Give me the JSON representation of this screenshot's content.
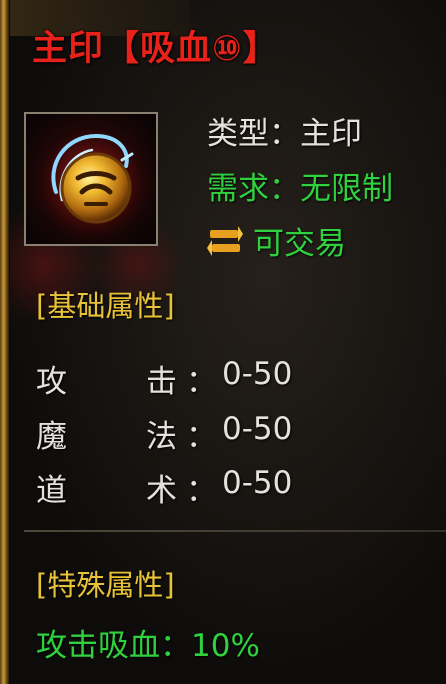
{
  "item": {
    "title": "主印【吸血⑩】",
    "icon": "golden-seal-orb-icon"
  },
  "info": {
    "type_line": "类型：主印",
    "requirement_line": "需求：无限制",
    "trade_label": "可交易",
    "trade_icon": "trade-arrows-icon"
  },
  "basic_attributes": {
    "header": "[基础属性]",
    "rows": [
      {
        "c1": "攻",
        "c2": "击",
        "colon": "：",
        "value": "0-50"
      },
      {
        "c1": "魔",
        "c2": "法",
        "colon": "：",
        "value": "0-50"
      },
      {
        "c1": "道",
        "c2": "术",
        "colon": "：",
        "value": "0-50"
      }
    ]
  },
  "special_attributes": {
    "header": "[特殊属性]",
    "lifesteal": "攻击吸血：10%"
  },
  "colors": {
    "title_red": "#e8221a",
    "green": "#2fd13f",
    "gold": "#e8c338",
    "white": "#e4e2dc"
  }
}
